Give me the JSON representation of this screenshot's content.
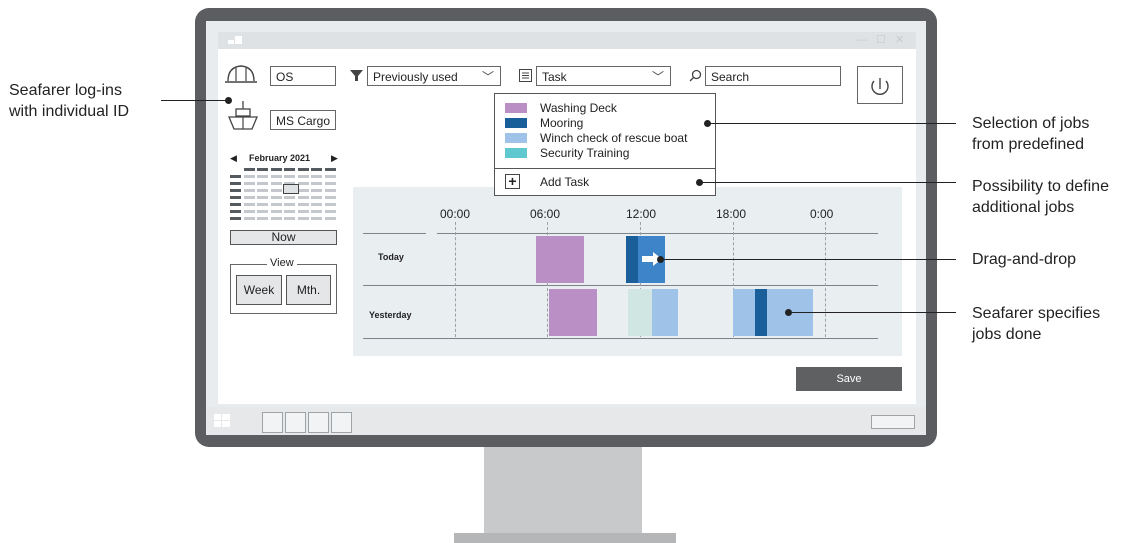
{
  "app": {
    "user_id": "OS",
    "vessel": "MS Cargo",
    "filter_value": "Previously used",
    "task_value": "Task",
    "search_placeholder": "Search"
  },
  "calendar": {
    "month": "February 2021",
    "now_label": "Now"
  },
  "view": {
    "legend": "View",
    "week_label": "Week",
    "month_label": "Mth."
  },
  "tasks": [
    {
      "label": "Washing Deck",
      "color": "#b98fc5"
    },
    {
      "label": "Mooring",
      "color": "#1a5e9a"
    },
    {
      "label": "Winch check of rescue boat",
      "color": "#9fc3e8"
    },
    {
      "label": "Security Training",
      "color": "#62c8cf"
    }
  ],
  "add_task_label": "Add Task",
  "timeline": {
    "hours": [
      "00:00",
      "06:00",
      "12:00",
      "18:00",
      "0:00"
    ],
    "rows": [
      "Today",
      "Yesterday"
    ]
  },
  "save_label": "Save",
  "annotations": {
    "left": [
      "Seafarer log-ins",
      "with individual ID"
    ],
    "selection": [
      "Selection of jobs",
      "from predefined"
    ],
    "define": [
      "Possibility to define",
      "additional jobs"
    ],
    "drag": "Drag-and-drop",
    "specifies": [
      "Seafarer specifies",
      "jobs done"
    ]
  },
  "colors": {
    "washing": "#b98fc5",
    "mooring": "#1a5e9a",
    "mooring_drag": "#3d84c8",
    "winch": "#9fc3e8",
    "security_faint": "#cfe6e2",
    "bezel": "#5b5d60"
  }
}
